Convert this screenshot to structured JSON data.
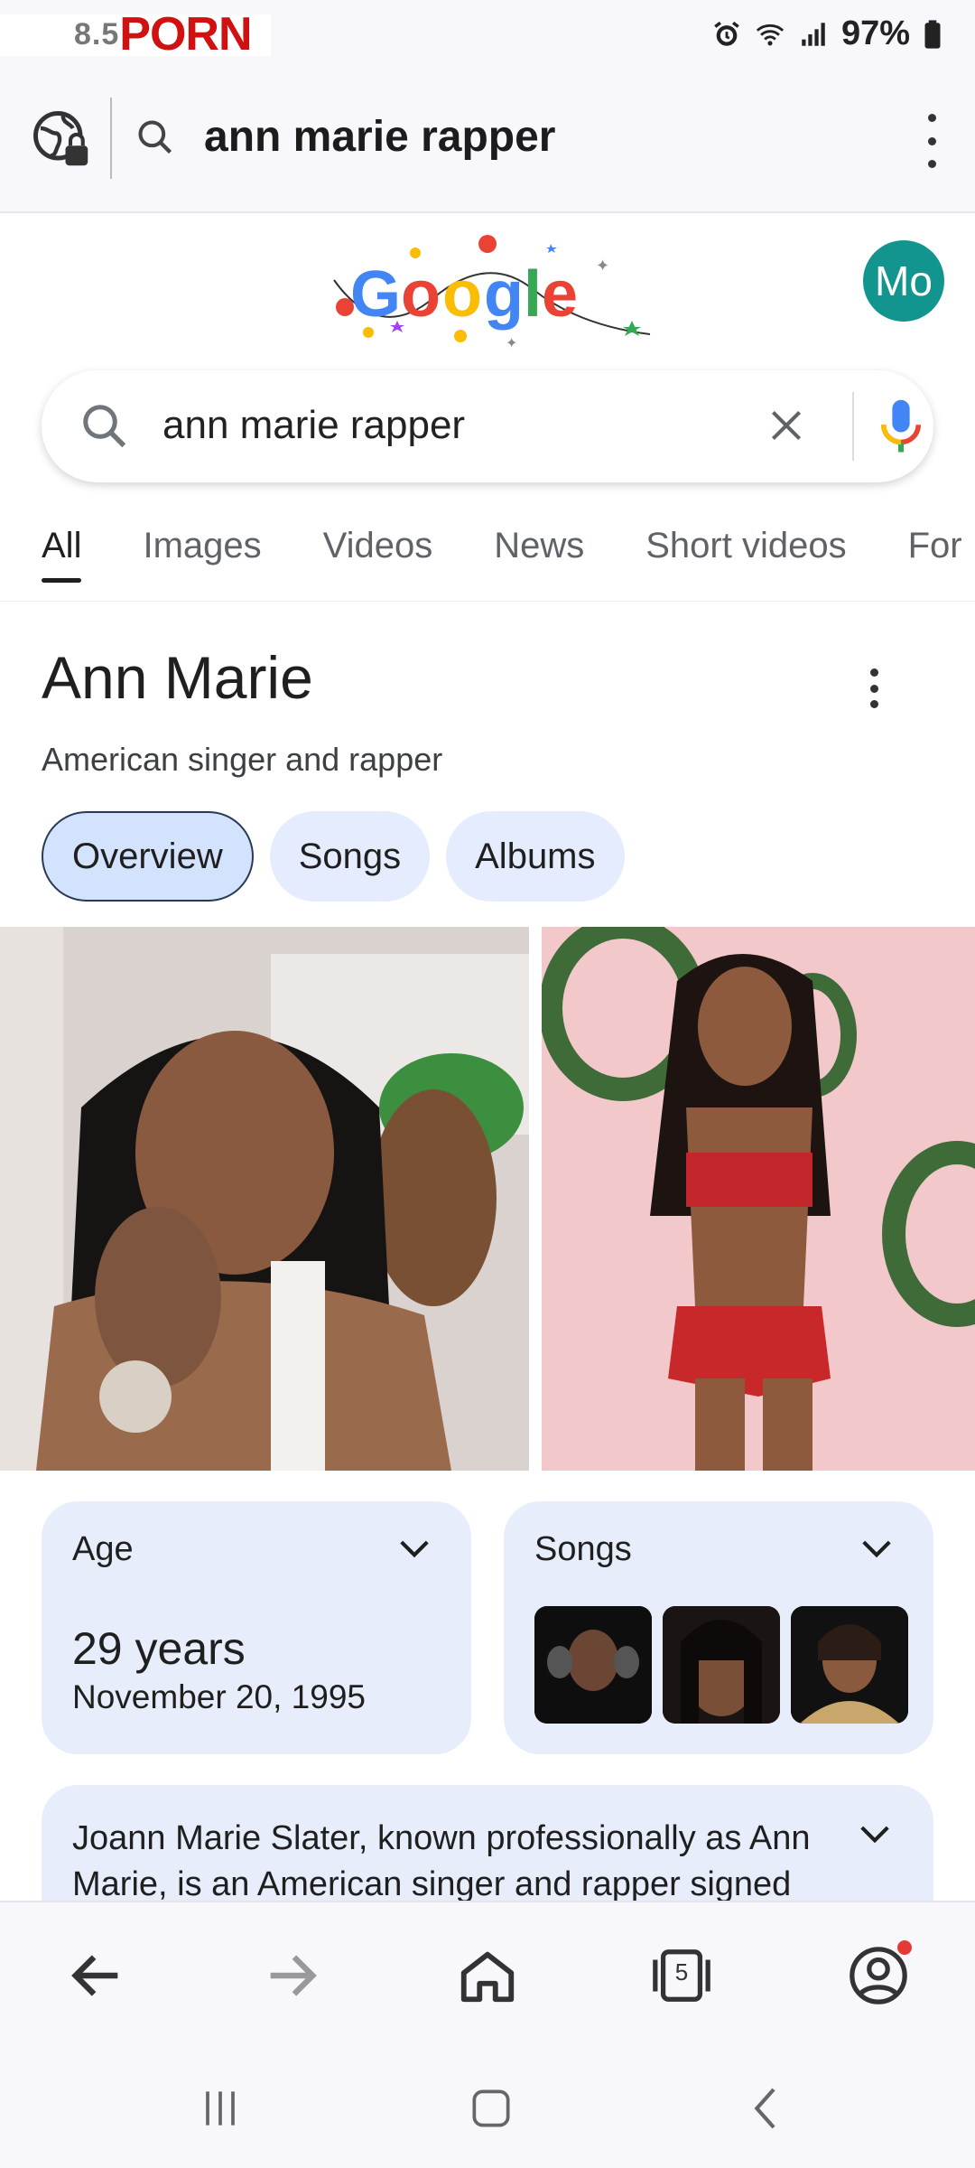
{
  "status_bar": {
    "app_prefix": "8.5",
    "app_brand": "PORN",
    "battery": "97%"
  },
  "url_bar": {
    "query": "ann marie rapper"
  },
  "google": {
    "avatar_initials": "Mo",
    "search_query": "ann marie rapper"
  },
  "tabs": [
    {
      "label": "All",
      "active": true
    },
    {
      "label": "Images",
      "active": false
    },
    {
      "label": "Videos",
      "active": false
    },
    {
      "label": "News",
      "active": false
    },
    {
      "label": "Short videos",
      "active": false
    },
    {
      "label": "For",
      "active": false
    }
  ],
  "knowledge_panel": {
    "title": "Ann Marie",
    "subtitle": "American singer and rapper",
    "chips": [
      "Overview",
      "Songs",
      "Albums"
    ],
    "age_card": {
      "label": "Age",
      "value": "29 years",
      "date": "November 20, 1995"
    },
    "songs_card": {
      "label": "Songs"
    },
    "description": "Joann Marie Slater, known professionally as Ann Marie, is an American singer and rapper signed"
  },
  "toolbar": {
    "tab_count": "5"
  },
  "colors": {
    "brand_red": "#cf1111",
    "avatar": "#11958e",
    "chip_bg": "#e5ecfd",
    "card_bg": "#e8edfb",
    "notification_dot": "#e53935"
  },
  "icons": {
    "site_info": "globe-lock-icon",
    "search": "search-icon",
    "clear": "close-icon",
    "mic": "mic-icon",
    "back": "arrow-left-icon",
    "forward": "arrow-right-icon",
    "home": "home-icon",
    "tabs": "tabs-icon",
    "account": "account-icon"
  }
}
